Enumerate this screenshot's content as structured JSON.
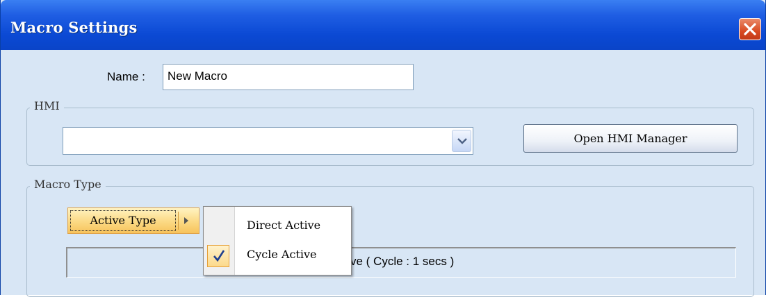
{
  "window": {
    "title": "Macro Settings"
  },
  "name_field": {
    "label": "Name :",
    "value": "New Macro"
  },
  "hmi_group": {
    "legend": "HMI",
    "combo_value": "",
    "open_button": "Open HMI Manager"
  },
  "macro_type_group": {
    "legend": "Macro Type",
    "active_type_button": "Active Type",
    "status_text": "ctive ( Cycle : 1 secs )"
  },
  "context_menu": {
    "items": [
      {
        "label": "Direct Active",
        "checked": false
      },
      {
        "label": "Cycle Active",
        "checked": true
      }
    ]
  },
  "colors": {
    "titlebar": "#0b49d4",
    "body": "#d8e6f5",
    "highlight": "#fbd983",
    "close": "#d94b22"
  },
  "icons": [
    "close-icon",
    "chevron-down-icon",
    "arrow-right-icon",
    "checkmark-icon"
  ]
}
